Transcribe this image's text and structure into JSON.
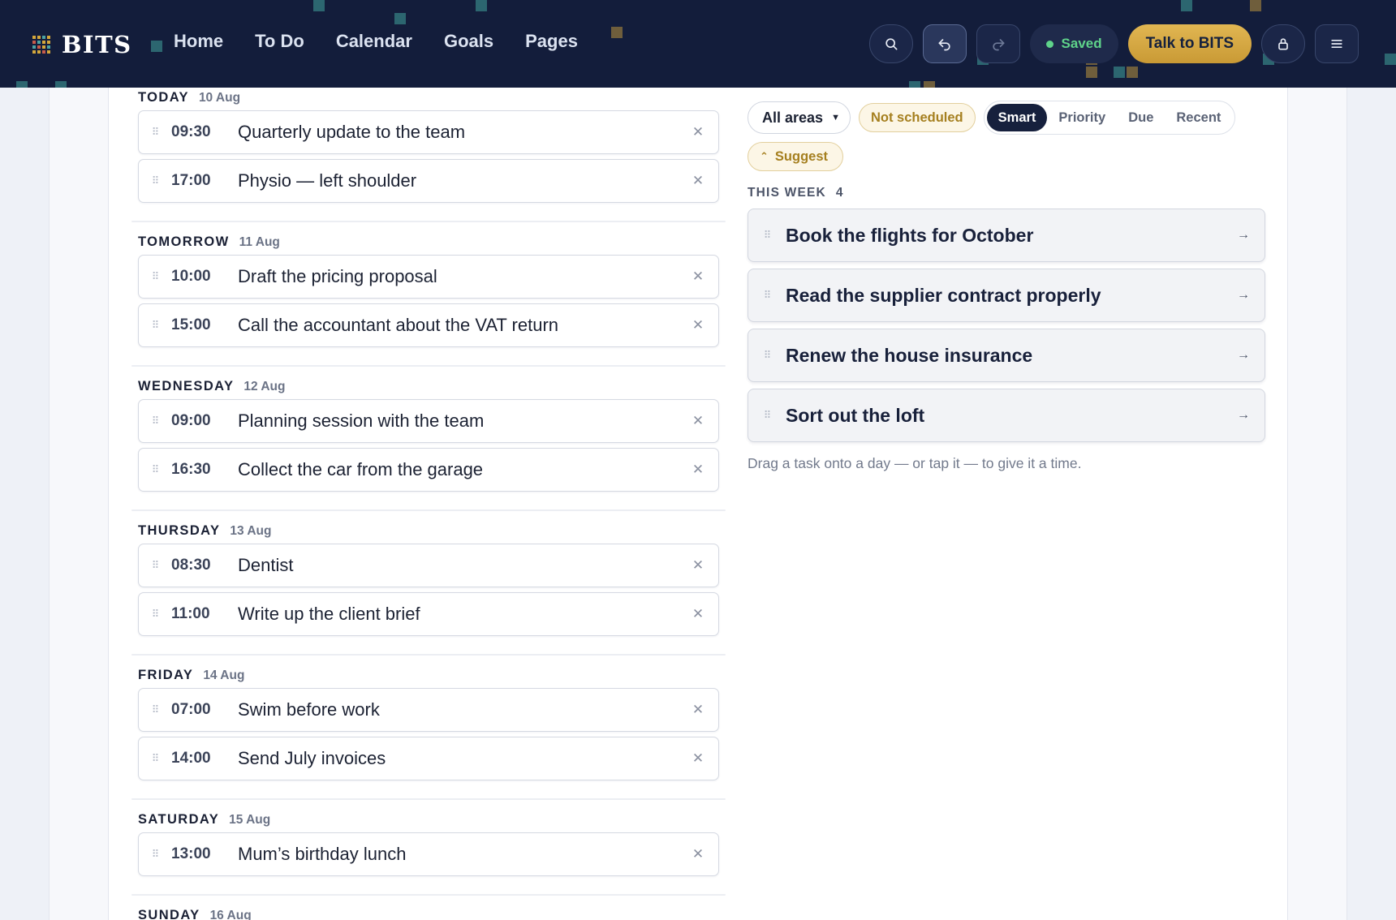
{
  "brand": {
    "name": "BITS"
  },
  "nav": [
    "Home",
    "To Do",
    "Calendar",
    "Goals",
    "Pages"
  ],
  "toolbar": {
    "saved_label": "Saved",
    "talk_label": "Talk to BITS",
    "icons": [
      "search-icon",
      "undo-icon",
      "redo-icon",
      "lock-icon",
      "menu-icon"
    ]
  },
  "schedule": [
    {
      "day": "TODAY",
      "date": "10 Aug",
      "items": [
        {
          "time": "09:30",
          "title": "Quarterly update to the team"
        },
        {
          "time": "17:00",
          "title": "Physio — left shoulder"
        }
      ]
    },
    {
      "day": "TOMORROW",
      "date": "11 Aug",
      "items": [
        {
          "time": "10:00",
          "title": "Draft the pricing proposal"
        },
        {
          "time": "15:00",
          "title": "Call the accountant about the VAT return"
        }
      ]
    },
    {
      "day": "WEDNESDAY",
      "date": "12 Aug",
      "items": [
        {
          "time": "09:00",
          "title": "Planning session with the team"
        },
        {
          "time": "16:30",
          "title": "Collect the car from the garage"
        }
      ]
    },
    {
      "day": "THURSDAY",
      "date": "13 Aug",
      "items": [
        {
          "time": "08:30",
          "title": "Dentist"
        },
        {
          "time": "11:00",
          "title": "Write up the client brief"
        }
      ]
    },
    {
      "day": "FRIDAY",
      "date": "14 Aug",
      "items": [
        {
          "time": "07:00",
          "title": "Swim before work"
        },
        {
          "time": "14:00",
          "title": "Send July invoices"
        }
      ]
    },
    {
      "day": "SATURDAY",
      "date": "15 Aug",
      "items": [
        {
          "time": "13:00",
          "title": "Mum’s birthday lunch"
        }
      ]
    },
    {
      "day": "SUNDAY",
      "date": "16 Aug",
      "items": []
    }
  ],
  "filters": {
    "area_select": "All areas",
    "not_scheduled": "Not scheduled",
    "sort_options": [
      "Smart",
      "Priority",
      "Due",
      "Recent"
    ],
    "sort_active": "Smart",
    "suggest": "Suggest"
  },
  "this_week": {
    "label": "THIS WEEK",
    "count": "4",
    "tasks": [
      "Book the flights for October",
      "Read the supplier contract properly",
      "Renew the house insurance",
      "Sort out the loft"
    ]
  },
  "hint": "Drag a task onto a day — or tap it — to give it a time."
}
